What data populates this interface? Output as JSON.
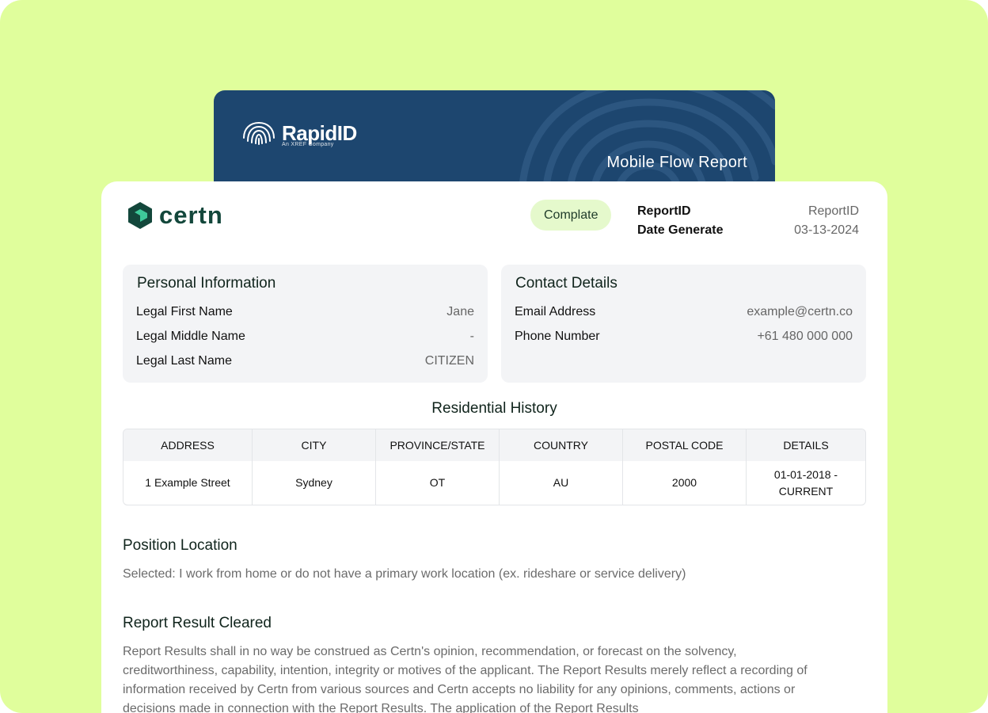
{
  "brand": {
    "rapid_name": "RapidID",
    "rapid_tagline": "An XREF Company",
    "report_type": "Mobile Flow Report",
    "certn_name": "certn",
    "colors": {
      "background": "#e0fe9c",
      "rapid_blue": "#1d466f",
      "certn_green": "#13473b",
      "pill": "#e5f9cc"
    }
  },
  "header": {
    "status": "Complate",
    "report_id_label": "ReportID",
    "report_id_value": "ReportID",
    "date_label": "Date Generate",
    "date_value": "03-13-2024"
  },
  "personal": {
    "title": "Personal Information",
    "rows": [
      {
        "label": "Legal First Name",
        "value": "Jane"
      },
      {
        "label": "Legal Middle Name",
        "value": "-"
      },
      {
        "label": "Legal Last Name",
        "value": "CITIZEN"
      }
    ]
  },
  "contact": {
    "title": "Contact Details",
    "rows": [
      {
        "label": "Email Address",
        "value": "example@certn.co"
      },
      {
        "label": "Phone Number",
        "value": "+61 480 000 000"
      }
    ]
  },
  "residential": {
    "title": "Residential History",
    "columns": [
      "ADDRESS",
      "CITY",
      "PROVINCE/STATE",
      "COUNTRY",
      "POSTAL CODE",
      "DETAILS"
    ],
    "rows": [
      [
        "1 Example Street",
        "Sydney",
        "OT",
        "AU",
        "2000",
        "01-01-2018 - CURRENT"
      ]
    ]
  },
  "position": {
    "title": "Position Location",
    "text": "Selected: I work from home or do not have a primary work location (ex. rideshare or service delivery)"
  },
  "result": {
    "title": "Report Result Cleared",
    "text": "Report Results shall in no way be construed as Certn's opinion, recommendation, or forecast on the solvency, creditworthiness, capability, intention, integrity or motives of the applicant. The Report Results merely reflect a recording of information received by Certn from various sources and Certn accepts no liability for any opinions, comments, actions or decisions made in connection with the Report Results. The application of the Report Results"
  },
  "icons": {
    "rapid": "fingerprint-icon",
    "certn": "certn-hexagon-icon"
  }
}
